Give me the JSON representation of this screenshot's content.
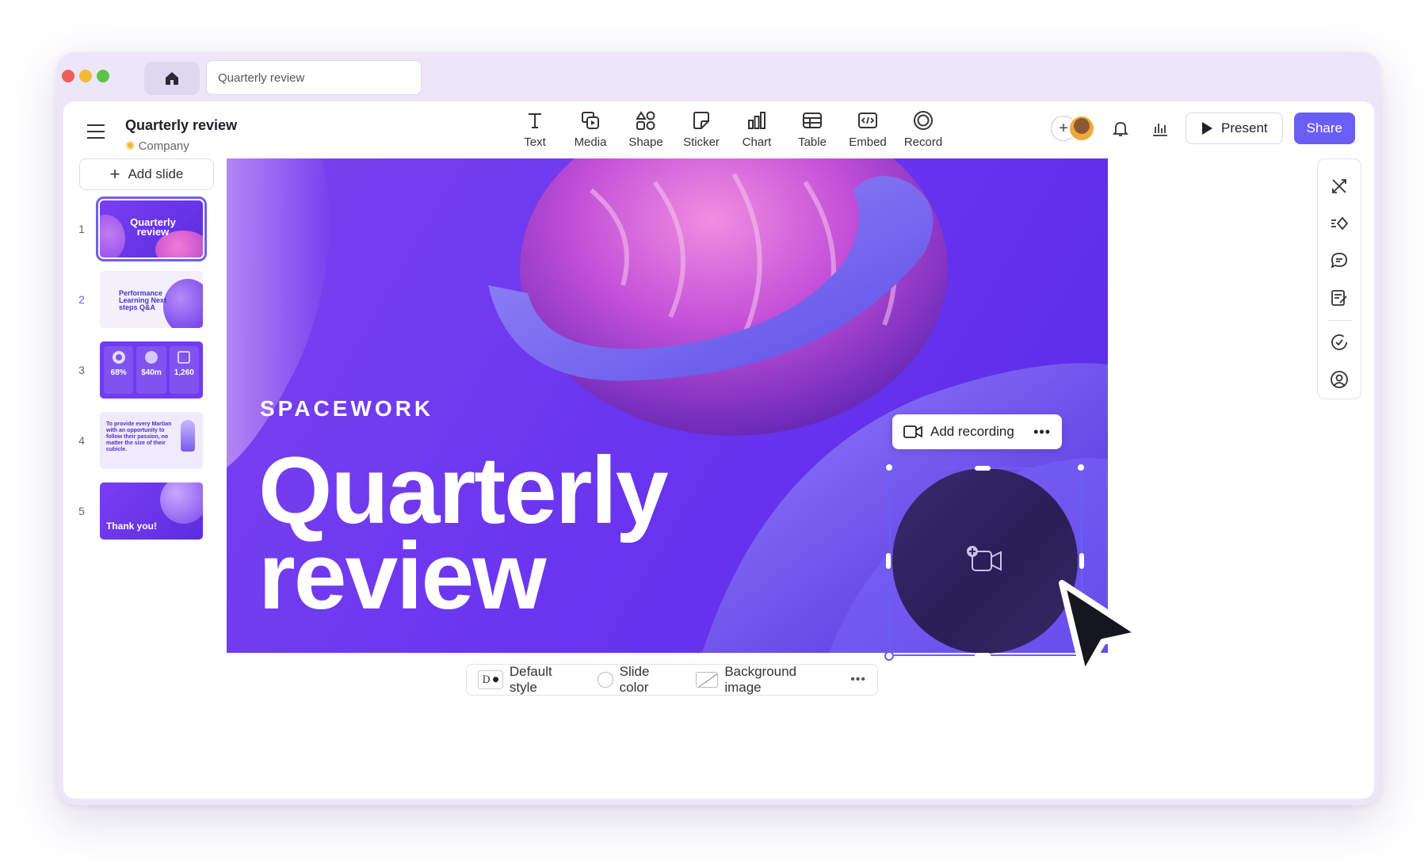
{
  "browser": {
    "tab_title": "Quarterly review"
  },
  "header": {
    "title": "Quarterly review",
    "workspace": "Company",
    "tools": [
      {
        "label": "Text"
      },
      {
        "label": "Media"
      },
      {
        "label": "Shape"
      },
      {
        "label": "Sticker"
      },
      {
        "label": "Chart"
      },
      {
        "label": "Table"
      },
      {
        "label": "Embed"
      },
      {
        "label": "Record"
      }
    ],
    "present_label": "Present",
    "share_label": "Share"
  },
  "sidebar": {
    "add_slide_label": "Add slide",
    "slides": [
      {
        "num": "1",
        "text": "Quarterly review"
      },
      {
        "num": "2",
        "text": "Performance Learning Next steps Q&A"
      },
      {
        "num": "3",
        "stats": [
          "68%",
          "$40m",
          "1,260"
        ]
      },
      {
        "num": "4",
        "text": "To provide every Martian with an opportunity to follow their passion, no matter the size of their cubicle."
      },
      {
        "num": "5",
        "text": "Thank you!"
      }
    ]
  },
  "slide": {
    "logo": "SPACEWORK",
    "title_line1": "Quarterly",
    "title_line2": "review",
    "add_recording_label": "Add recording"
  },
  "bottom_bar": {
    "style_label": "Default style",
    "color_label": "Slide color",
    "bg_label": "Background image"
  },
  "colors": {
    "accent": "#6b5ef5",
    "slide_bg": "#6b36f0"
  }
}
